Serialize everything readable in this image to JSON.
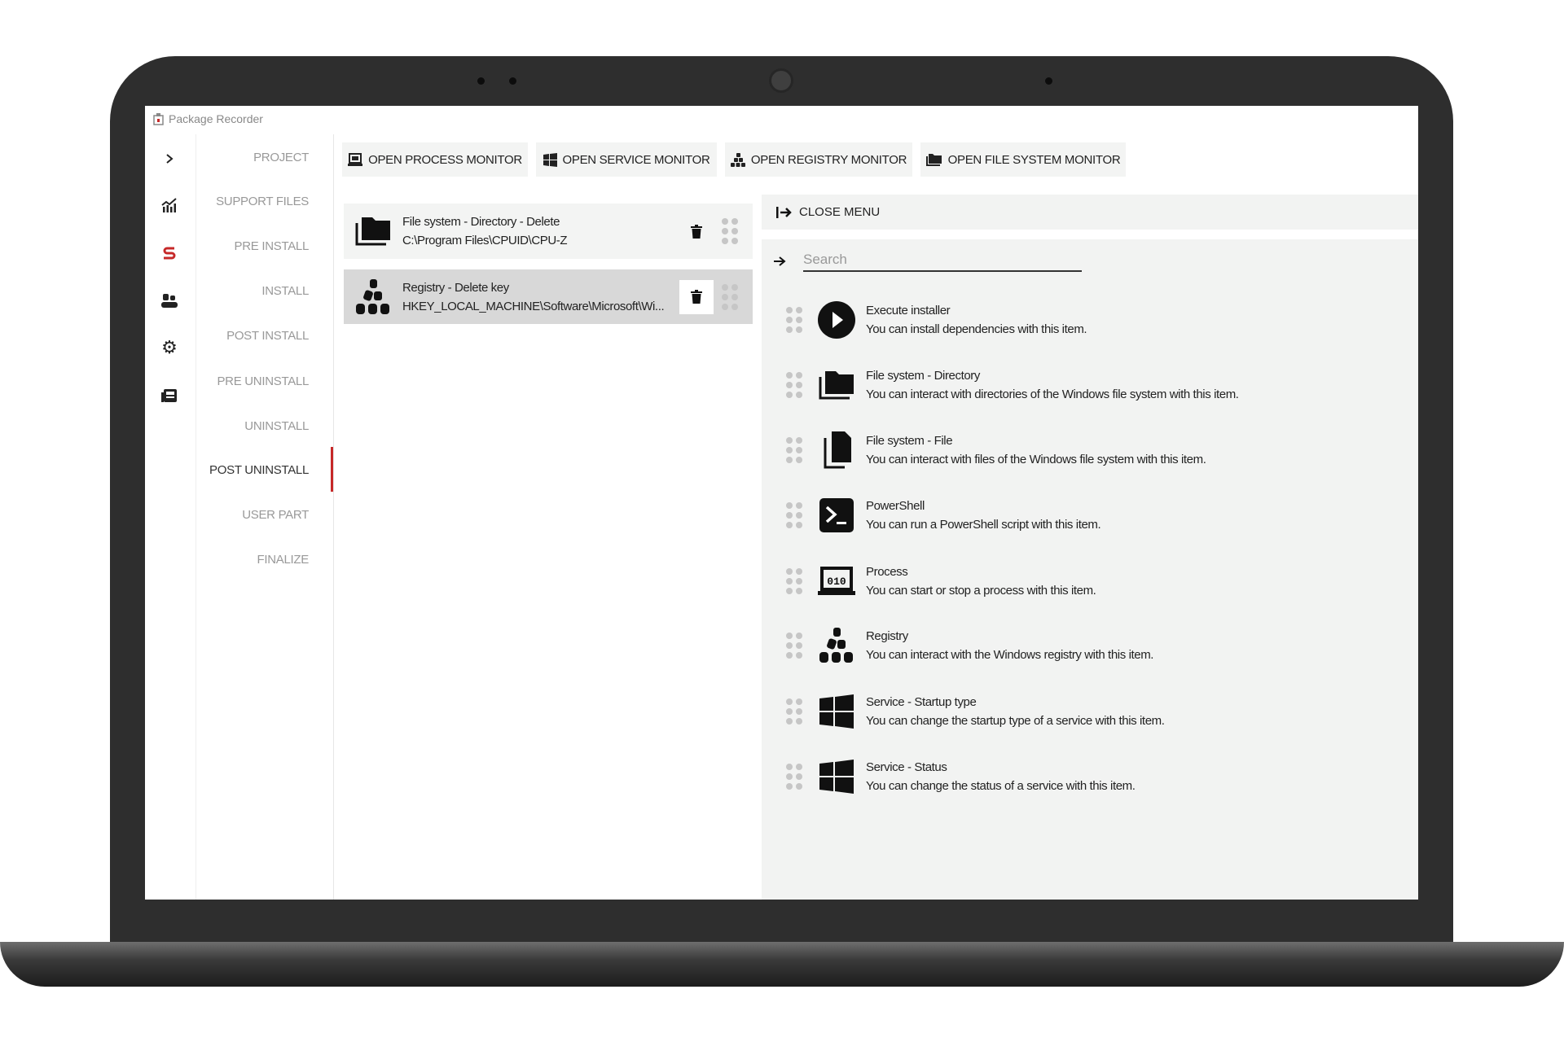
{
  "window": {
    "title": "Package Recorder"
  },
  "rail": {
    "items": [
      {
        "icon": "chevron-right-icon"
      },
      {
        "icon": "chart-icon"
      },
      {
        "icon": "swap-icon",
        "color": "#c62828"
      },
      {
        "icon": "users-icon"
      },
      {
        "icon": "gear-icon"
      },
      {
        "icon": "news-icon"
      }
    ]
  },
  "nav": {
    "items": [
      {
        "label": "PROJECT"
      },
      {
        "label": "SUPPORT FILES"
      },
      {
        "label": "PRE INSTALL"
      },
      {
        "label": "INSTALL"
      },
      {
        "label": "POST INSTALL"
      },
      {
        "label": "PRE UNINSTALL"
      },
      {
        "label": "UNINSTALL"
      },
      {
        "label": "POST UNINSTALL",
        "active": true
      },
      {
        "label": "USER PART"
      },
      {
        "label": "FINALIZE"
      }
    ],
    "active_color": "#c62828"
  },
  "toolbar": {
    "process": "OPEN PROCESS MONITOR",
    "service": "OPEN SERVICE MONITOR",
    "registry": "OPEN REGISTRY MONITOR",
    "filesystem": "OPEN FILE SYSTEM MONITOR"
  },
  "steps": [
    {
      "title": "File system - Directory - Delete",
      "detail": "C:\\Program Files\\CPUID\\CPU-Z",
      "icon": "folder-icon"
    },
    {
      "title": "Registry - Delete key",
      "detail": "HKEY_LOCAL_MACHINE\\Software\\Microsoft\\Wi...",
      "icon": "registry-icon",
      "selected": true
    }
  ],
  "menu": {
    "close_label": "CLOSE MENU",
    "search_placeholder": "Search",
    "search_value": "",
    "items": [
      {
        "title": "Execute installer",
        "desc": "You can install dependencies with this item.",
        "icon": "play-icon"
      },
      {
        "title": "File system - Directory",
        "desc": "You can interact with directories of the Windows file system with this item.",
        "icon": "folder-icon"
      },
      {
        "title": "File system - File",
        "desc": "You can interact with files of the Windows file system with this item.",
        "icon": "file-icon"
      },
      {
        "title": "PowerShell",
        "desc": "You can run a PowerShell script with this item.",
        "icon": "powershell-icon"
      },
      {
        "title": "Process",
        "desc": "You can start or stop a process with this item.",
        "icon": "process-icon"
      },
      {
        "title": "Registry",
        "desc": "You can interact with the Windows registry with this item.",
        "icon": "registry-icon"
      },
      {
        "title": "Service - Startup type",
        "desc": "You can change the startup type of a service with this item.",
        "icon": "windows-icon"
      },
      {
        "title": "Service - Status",
        "desc": "You can change the status of a service with this item.",
        "icon": "windows-icon"
      }
    ]
  }
}
